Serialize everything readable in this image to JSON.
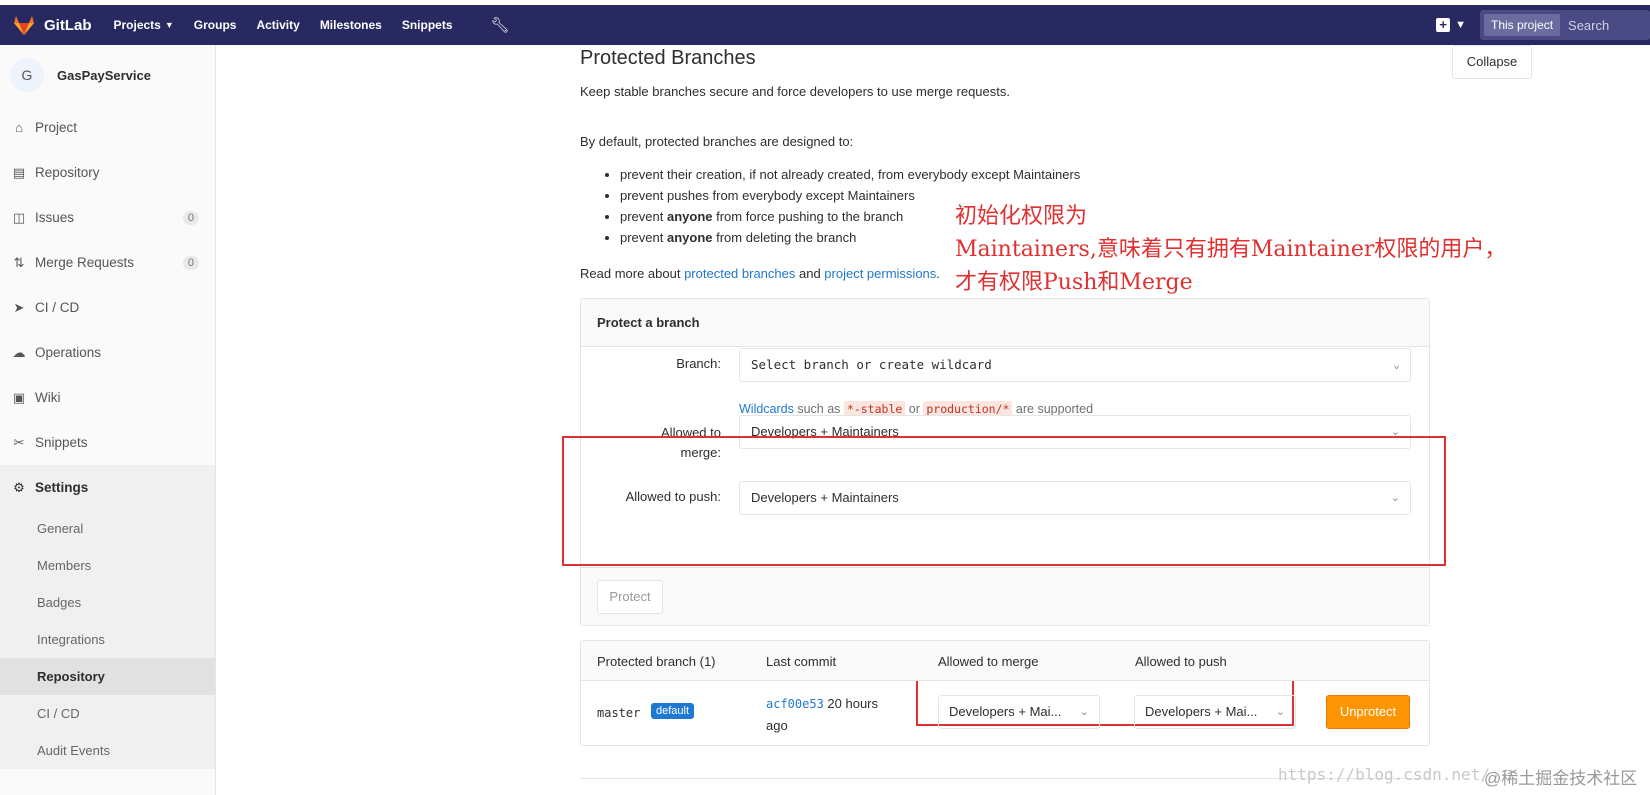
{
  "navbar": {
    "brand": "GitLab",
    "items": [
      {
        "label": "Projects",
        "dropdown": true
      },
      {
        "label": "Groups"
      },
      {
        "label": "Activity"
      },
      {
        "label": "Milestones"
      },
      {
        "label": "Snippets"
      }
    ],
    "search_scope": "This project",
    "search_placeholder": "Search"
  },
  "sidebar": {
    "project_initial": "G",
    "project_name": "GasPayService",
    "items": [
      {
        "label": "Project",
        "icon": "home-icon"
      },
      {
        "label": "Repository",
        "icon": "book-icon"
      },
      {
        "label": "Issues",
        "icon": "issues-icon",
        "count": "0"
      },
      {
        "label": "Merge Requests",
        "icon": "merge-request-icon",
        "count": "0"
      },
      {
        "label": "CI / CD",
        "icon": "rocket-icon"
      },
      {
        "label": "Operations",
        "icon": "cloud-gear-icon"
      },
      {
        "label": "Wiki",
        "icon": "wiki-icon"
      },
      {
        "label": "Snippets",
        "icon": "scissors-icon"
      },
      {
        "label": "Settings",
        "icon": "gear-icon"
      }
    ],
    "settings_sub": [
      "General",
      "Members",
      "Badges",
      "Integrations",
      "Repository",
      "CI / CD",
      "Audit Events"
    ]
  },
  "main": {
    "title": "Protected Branches",
    "subtitle": "Keep stable branches secure and force developers to use merge requests.",
    "collapse": "Collapse",
    "intro": "By default, protected branches are designed to:",
    "bullets": [
      {
        "pre": "prevent their creation, if not already created, from everybody except Maintainers",
        "bold": "",
        "post": ""
      },
      {
        "pre": "prevent pushes from everybody except Maintainers",
        "bold": "",
        "post": ""
      },
      {
        "pre": "prevent ",
        "bold": "anyone",
        "post": " from force pushing to the branch"
      },
      {
        "pre": "prevent ",
        "bold": "anyone",
        "post": " from deleting the branch"
      }
    ],
    "readmore_pre": "Read more about ",
    "readmore_link1": "protected branches",
    "readmore_mid": " and ",
    "readmore_link2": "project permissions",
    "readmore_post": "."
  },
  "annotation": {
    "line1": "初始化权限为",
    "line2": "Maintainers,意味着只有拥有Maintainer权限的用户，",
    "line3": "才有权限Push和Merge"
  },
  "protect_form": {
    "header": "Protect a branch",
    "branch_label": "Branch:",
    "branch_placeholder": "Select branch or create wildcard",
    "hint_link": "Wildcards",
    "hint_text1": " such as ",
    "hint_code1": "*-stable",
    "hint_text2": " or ",
    "hint_code2": "production/*",
    "hint_text3": " are supported",
    "merge_label_1": "Allowed to",
    "merge_label_2": "merge:",
    "merge_value": "Developers + Maintainers",
    "push_label": "Allowed to push:",
    "push_value": "Developers + Maintainers",
    "protect_button": "Protect"
  },
  "table": {
    "headers": [
      "Protected branch (1)",
      "Last commit",
      "Allowed to merge",
      "Allowed to push"
    ],
    "row": {
      "branch": "master",
      "badge": "default",
      "commit_sha": "acf00e53",
      "commit_time_1": " 20 hours",
      "commit_time_2": "ago",
      "merge_value": "Developers + Mai...",
      "push_value": "Developers + Mai...",
      "unprotect": "Unprotect"
    }
  },
  "watermark": {
    "url": "https://blog.csdn.net/",
    "site": "@稀土掘金技术社区"
  },
  "colors": {
    "navbar": "#292961",
    "link": "#1f78d1",
    "annotation": "#e03030",
    "unprotect": "#fc9403"
  }
}
